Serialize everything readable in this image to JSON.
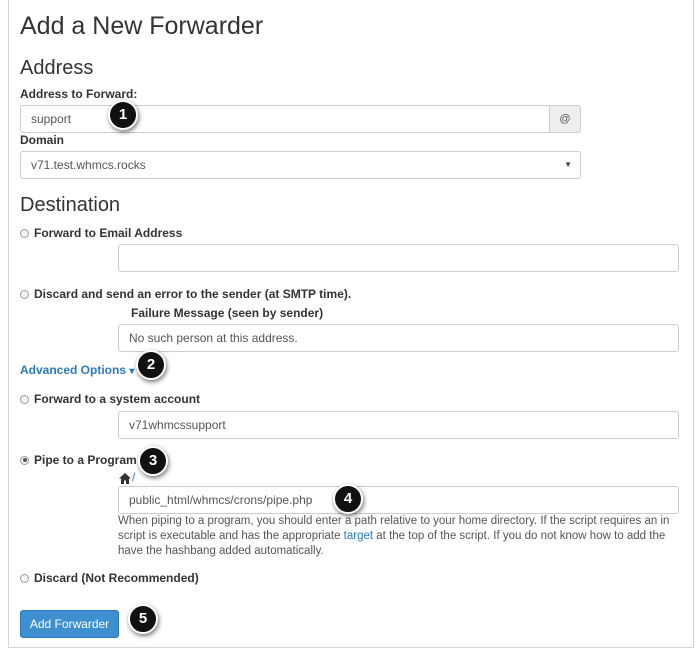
{
  "page_title": "Add a New Forwarder",
  "address_section": {
    "heading": "Address",
    "address_label": "Address to Forward:",
    "address_value": "support",
    "at_symbol": "@",
    "domain_label": "Domain",
    "domain_value": "v71.test.whmcs.rocks"
  },
  "destination_section": {
    "heading": "Destination",
    "forward_email_label": "Forward to Email Address",
    "forward_email_value": "",
    "discard_error_label": "Discard and send an error to the sender (at SMTP time).",
    "failure_message_label": "Failure Message (seen by sender)",
    "failure_message_value": "No such person at this address.",
    "advanced_options_label": "Advanced Options",
    "advanced_options_caret": "▾",
    "system_account_label": "Forward to a system account",
    "system_account_value": "v71whmcssupport",
    "pipe_label": "Pipe to a Program",
    "pipe_path_prefix": "/",
    "pipe_value": "public_html/whmcs/crons/pipe.php",
    "pipe_help_line1": "When piping to a program, you should enter a path relative to your home directory. If the script requires an in",
    "pipe_help_line2_before": "script is executable and has the appropriate ",
    "pipe_help_link": "target",
    "pipe_help_line2_after": " at the top of the script. If you do not know how to add the",
    "pipe_help_line3": "have the hashbang added automatically.",
    "discard_label": "Discard (Not Recommended)",
    "selected_option": "Pipe to a Program"
  },
  "add_button_label": "Add Forwarder",
  "annotations": [
    "1",
    "2",
    "3",
    "4",
    "5"
  ],
  "icons": {
    "home": "home-icon",
    "caret": "chevron-down-icon"
  },
  "colors": {
    "link": "#2a7ab9",
    "button": "#3d8fd0",
    "badge": "#111111"
  }
}
